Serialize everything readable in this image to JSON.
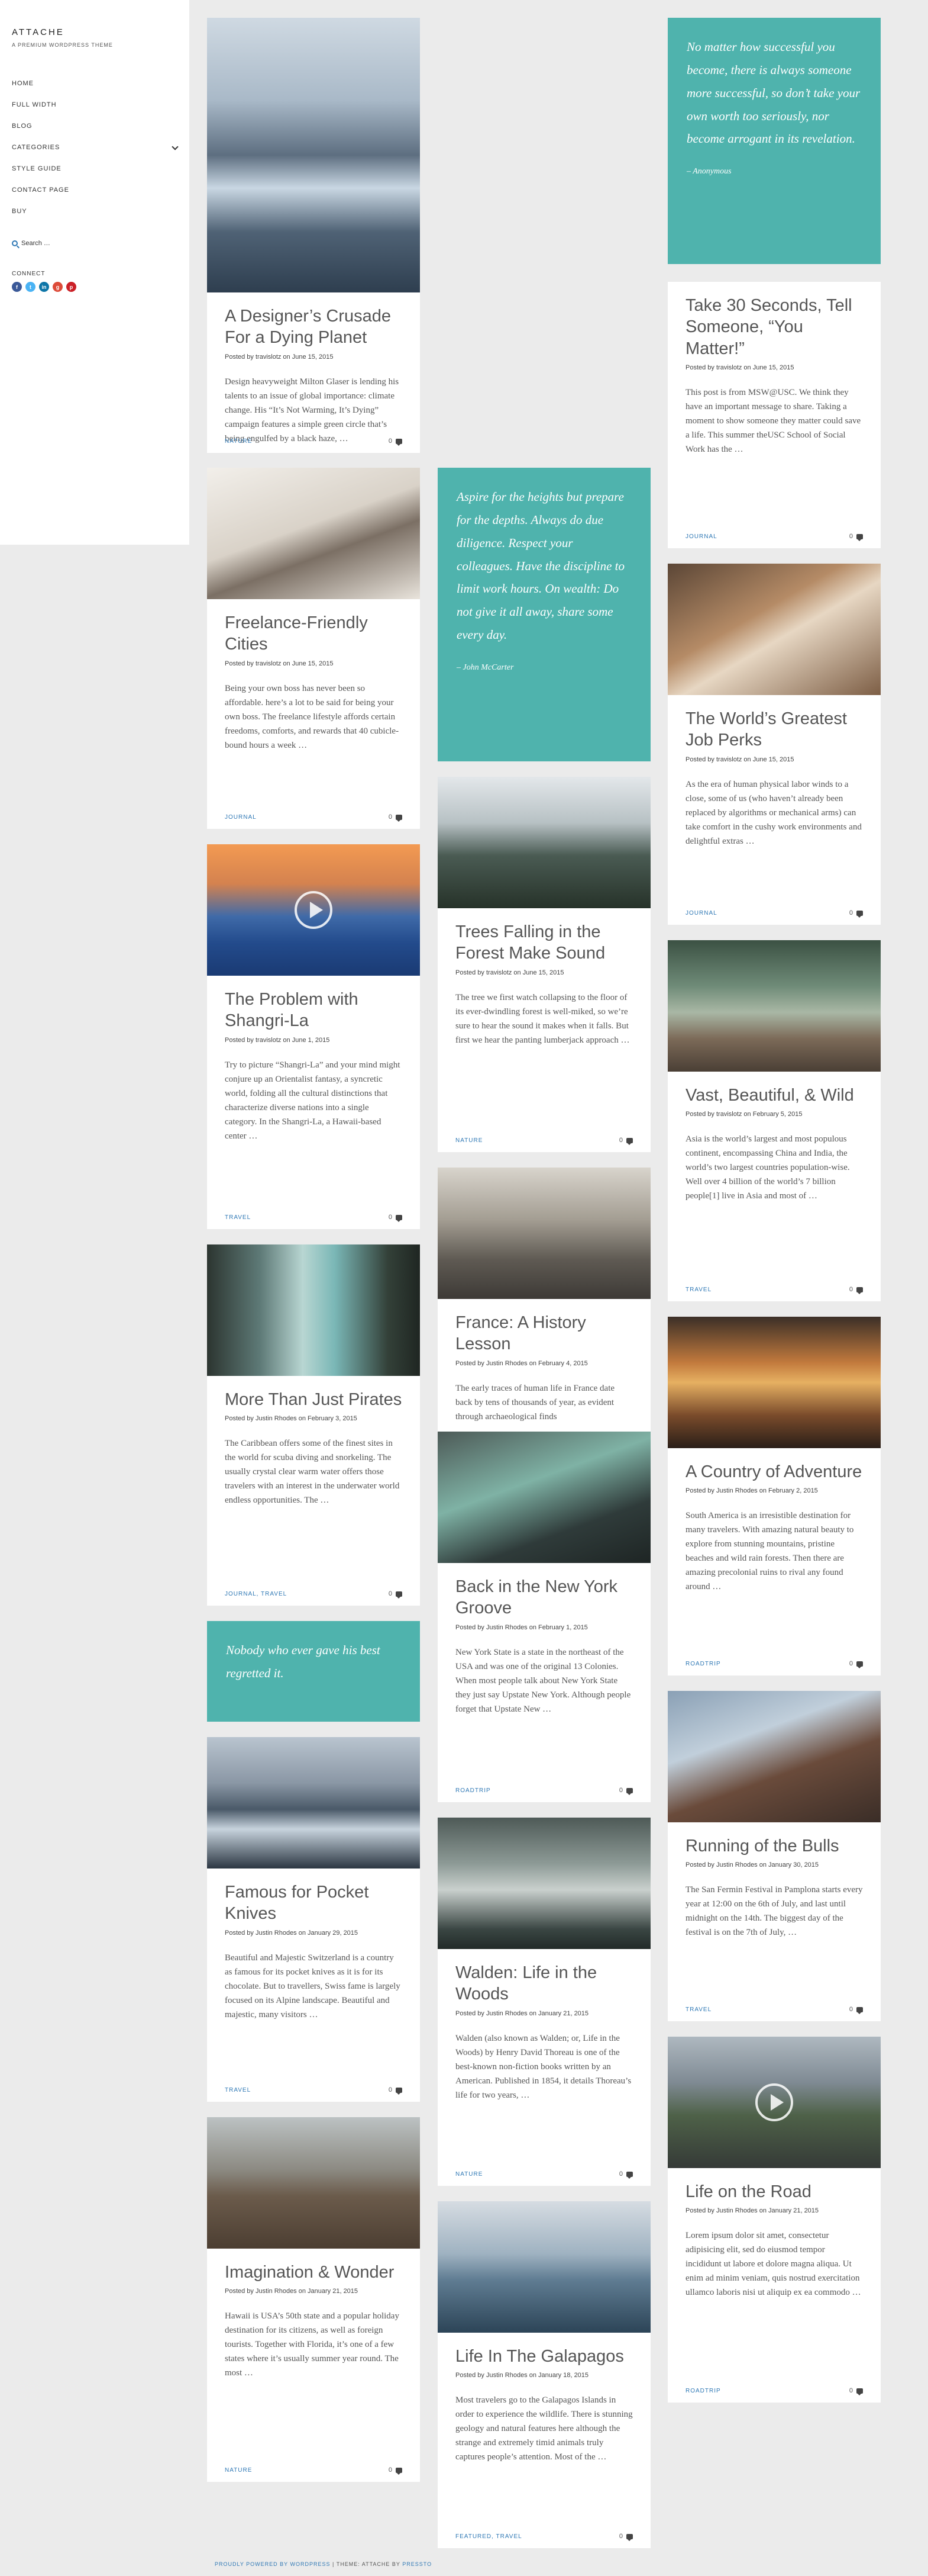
{
  "site": {
    "title": "ATTACHE",
    "tagline": "A PREMIUM WORDPRESS THEME"
  },
  "nav": [
    {
      "label": "HOME"
    },
    {
      "label": "FULL WIDTH"
    },
    {
      "label": "BLOG"
    },
    {
      "label": "CATEGORIES",
      "has_children": true
    },
    {
      "label": "STYLE GUIDE"
    },
    {
      "label": "CONTACT PAGE"
    },
    {
      "label": "BUY"
    }
  ],
  "search": {
    "label": "Search …"
  },
  "connect": {
    "label": "CONNECT",
    "networks": [
      "facebook-icon",
      "twitter-icon",
      "linkedin-icon",
      "google-plus-icon",
      "pinterest-icon"
    ]
  },
  "colors": {
    "accent": "#2f78b5",
    "quote_bg": "#4fb3ad",
    "background": "#ebebeb"
  },
  "col1": [
    {
      "kind": "post",
      "thumb": "glacier-lagoon",
      "big": true,
      "title": "A Designer’s Crusade For a Dying Planet",
      "meta": "Posted by travislotz on June 15, 2015",
      "excerpt": "Design heavyweight Milton Glaser is lending his talents to an issue of global importance: climate change. His “It’s Not Warming, It’s Dying” campaign features a simple green circle that’s being engulfed by a black haze, …",
      "category": "NATURE",
      "comments": "0"
    },
    {
      "kind": "post",
      "thumb": "laptop-on-bed",
      "title": "Freelance-Friendly Cities",
      "meta": "Posted by travislotz on June 15, 2015",
      "excerpt": "Being your own boss has never been so affordable. here’s a lot to be said for being your own boss. The freelance lifestyle affords certain freedoms, comforts, and rewards that 40 cubicle-bound hours a week …",
      "category": "JOURNAL",
      "comments": "0"
    },
    {
      "kind": "post",
      "thumb": "sunset-mountains",
      "video": true,
      "title": "The Problem with Shangri-La",
      "meta": "Posted by travislotz on June 1, 2015",
      "excerpt": "Try to picture “Shangri-La” and your mind might conjure up an Orientalist fantasy, a syncretic world, folding all the cultural distinctions that characterize diverse nations into a single category. In the Shangri-La, a Hawaii-based center …",
      "category": "TRAVEL",
      "comments": "0"
    },
    {
      "kind": "post",
      "thumb": "sea-cliffs",
      "title": "More Than Just Pirates",
      "meta": "Posted by Justin Rhodes on February 3, 2015",
      "excerpt": "The Caribbean offers some of the finest sites in the world for scuba diving and snorkeling. The usually crystal clear warm water offers those travelers with an interest in the underwater world endless opportunities. The …",
      "category": "JOURNAL, TRAVEL",
      "comments": "0"
    },
    {
      "kind": "quote",
      "text": "Nobody who ever gave his best regretted it.",
      "author": ""
    },
    {
      "kind": "post",
      "thumb": "alpine-lake",
      "title": "Famous for Pocket Knives",
      "meta": "Posted by Justin Rhodes on January 29, 2015",
      "excerpt": "Beautiful and Majestic Switzerland is a country as famous for its pocket knives as it is for its chocolate. But to travellers, Swiss fame is largely focused on its Alpine landscape. Beautiful and majestic, many visitors …",
      "category": "TRAVEL",
      "comments": "0"
    },
    {
      "kind": "post",
      "thumb": "volcano-plain",
      "title": "Imagination & Wonder",
      "meta": "Posted by Justin Rhodes on January 21, 2015",
      "excerpt": "Hawaii is USA’s 50th state and a popular holiday destination for its citizens, as well as foreign tourists. Together with Florida, it’s one of a few states where it’s usually summer year round. The most …",
      "category": "NATURE",
      "comments": "0"
    }
  ],
  "col2": [
    {
      "kind": "quote",
      "text": "Aspire for the heights but prepare for the depths. Always do due diligence. Respect your colleagues. Have the discipline to limit work hours. On wealth: Do not give it all away, share some every day.",
      "author": "– John McCarter"
    },
    {
      "kind": "post",
      "thumb": "snowy-forest",
      "title": "Trees Falling in the Forest Make Sound",
      "meta": "Posted by travislotz on June 15, 2015",
      "excerpt": "The tree we first watch collapsing to the floor of its ever-dwindling forest is well-miked, so we’re sure to hear the sound it makes when it falls. But first we hear the panting lumberjack approach …",
      "category": "NATURE",
      "comments": "0"
    },
    {
      "kind": "post",
      "thumb": "paris-skyline",
      "title": "France: A History Lesson",
      "meta": "Posted by Justin Rhodes on February 4, 2015",
      "excerpt": "The early traces of human life in France date back by tens of thousands of year, as evident through archaeological finds",
      "category": "",
      "comments": ""
    },
    {
      "kind": "post",
      "thumb": "green-scooter",
      "title": "Back in the New York Groove",
      "meta": "Posted by Justin Rhodes on February 1, 2015",
      "excerpt": "New York State is a state in the northeast of the USA and was one of the original 13 Colonies. When most people talk about New York State they just say Upstate New York. Although people forget that Upstate New …",
      "category": "ROADTRIP",
      "comments": "0"
    },
    {
      "kind": "post",
      "thumb": "misty-woods",
      "title": "Walden: Life in the Woods",
      "meta": "Posted by Justin Rhodes on January 21, 2015",
      "excerpt": "Walden (also known as Walden; or, Life in the Woods) by Henry David Thoreau is one of the best-known non-fiction books written by an American. Published in 1854, it details Thoreau’s life for two years, …",
      "category": "NATURE",
      "comments": "0"
    },
    {
      "kind": "post",
      "thumb": "paddleboard-sea",
      "title": "Life In The Galapagos",
      "meta": "Posted by Justin Rhodes on January 18, 2015",
      "excerpt": "Most travelers go to the Galapagos Islands in order to experience the wildlife. There is stunning geology and natural features here although the strange and extremely timid animals truly captures people’s attention. Most of the …",
      "category": "FEATURED, TRAVEL",
      "comments": "0"
    }
  ],
  "col3": [
    {
      "kind": "quote",
      "text": "No matter how successful you become, there is always someone more successful, so don’t take your own worth too seriously, nor become arrogant in its revelation.",
      "author": "– Anonymous"
    },
    {
      "kind": "post",
      "thumb": "",
      "title": "Take 30 Seconds, Tell Someone, “You Matter!”",
      "meta": "Posted by travislotz on June 15, 2015",
      "excerpt": "This post is from MSW@USC. We think they have an important message to share. Taking a moment to show someone they matter could save a life. This summer theUSC School of Social Work has the …",
      "category": "JOURNAL",
      "comments": "0"
    },
    {
      "kind": "post",
      "thumb": "hands-coffee",
      "title": "The World’s Greatest Job Perks",
      "meta": "Posted by travislotz on June 15, 2015",
      "excerpt": "As the era of human physical labor winds to a close, some of us (who haven’t already been replaced by algorithms or mechanical arms) can take comfort in the cushy work environments and delightful extras …",
      "category": "JOURNAL",
      "comments": "0"
    },
    {
      "kind": "post",
      "thumb": "lake-pier",
      "title": "Vast, Beautiful, & Wild",
      "meta": "Posted by travislotz on February 5, 2015",
      "excerpt": "Asia is the world’s largest and most populous continent, encompassing China and India, the world’s two largest countries population-wise. Well over 4 billion of the world’s 7 billion people[1] live in Asia and most of …",
      "category": "TRAVEL",
      "comments": "0"
    },
    {
      "kind": "post",
      "thumb": "desert-van",
      "title": "A Country of Adventure",
      "meta": "Posted by Justin Rhodes on February 2, 2015",
      "excerpt": "South America is an irresistible destination for many travelers. With amazing natural beauty to explore from stunning mountains, pristine beaches and wild rain forests. Then there are amazing precolonial ruins to rival any found around …",
      "category": "ROADTRIP",
      "comments": "0"
    },
    {
      "kind": "post",
      "thumb": "statue-building",
      "title": "Running of the Bulls",
      "meta": "Posted by Justin Rhodes on January 30, 2015",
      "excerpt": "The San Fermin Festival in Pamplona starts every year at 12:00 on the 6th of July, and last until midnight on the 14th. The biggest day of the festival is on the 7th of July, …",
      "category": "TRAVEL",
      "comments": "0"
    },
    {
      "kind": "post",
      "thumb": "mountain-road",
      "video": true,
      "title": "Life on the Road",
      "meta": "Posted by Justin Rhodes on January 21, 2015",
      "excerpt": "Lorem ipsum dolor sit amet, consectetur adipisicing elit, sed do eiusmod tempor incididunt ut labore et dolore magna aliqua. Ut enim ad minim veniam, quis nostrud exercitation ullamco laboris nisi ut aliquip ex ea commodo …",
      "category": "ROADTRIP",
      "comments": "0"
    }
  ],
  "footer": {
    "powered": "PROUDLY POWERED BY WORDPRESS",
    "sep": " | ",
    "theme": "THEME: ATTACHE BY ",
    "author": "PRESSTO"
  }
}
